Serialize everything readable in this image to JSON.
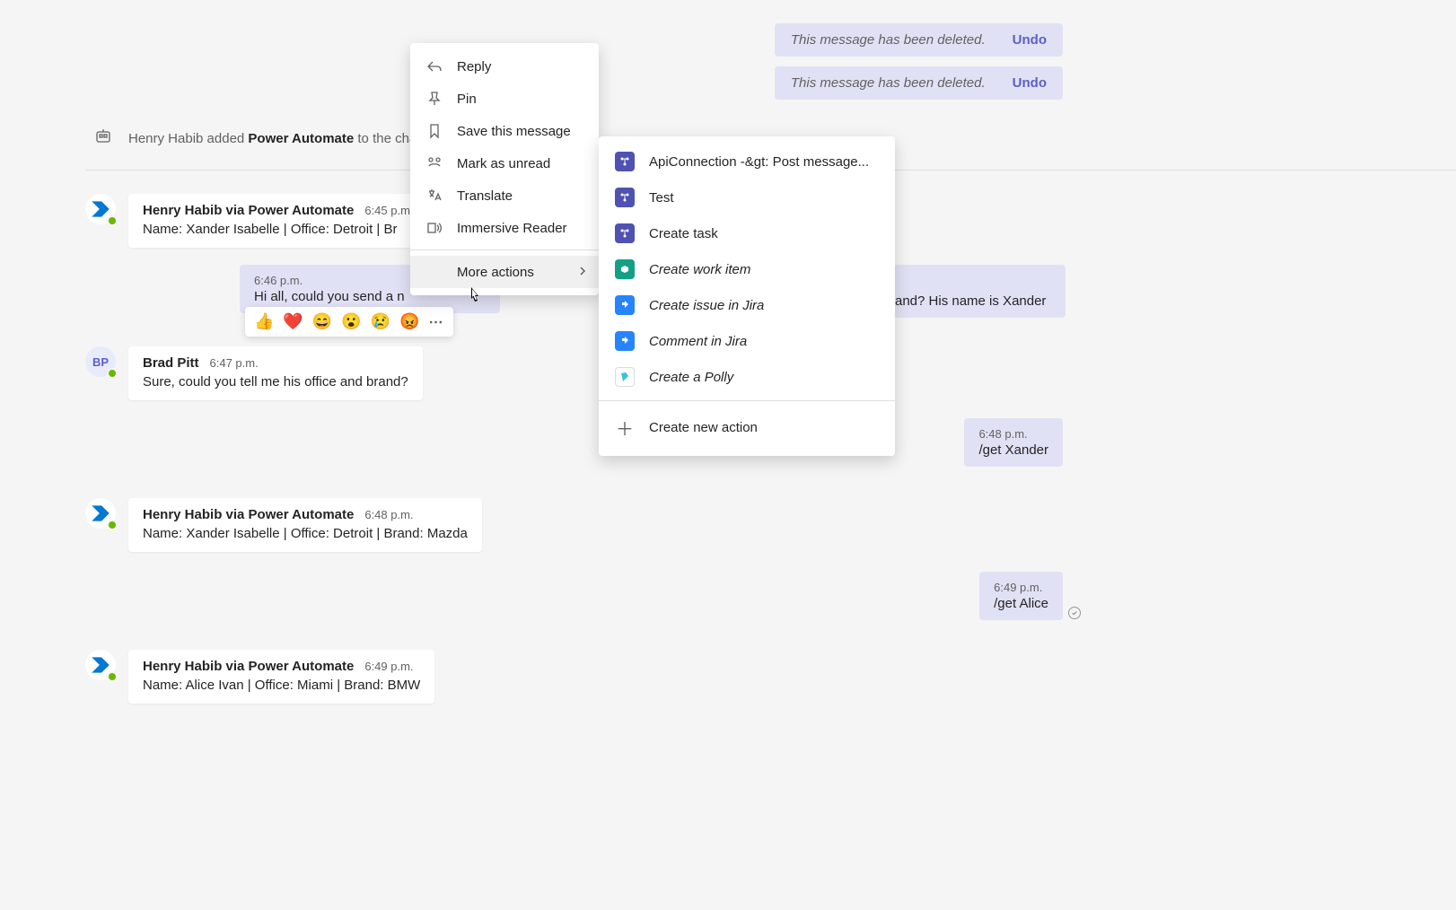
{
  "deleted": [
    {
      "text": "This message has been deleted.",
      "undo": "Undo"
    },
    {
      "text": "This message has been deleted.",
      "undo": "Undo"
    }
  ],
  "system_event": {
    "prefix": "Henry Habib added ",
    "bold": "Power Automate",
    "suffix": " to the chat."
  },
  "messages": {
    "pa1": {
      "name": "Henry Habib via Power Automate",
      "time": "6:45 p.m.",
      "body": "Name: Xander Isabelle | Office: Detroit | Br"
    },
    "mine_partial": {
      "time": "6:46 p.m.",
      "body": "Hi all, could you send a n",
      "body_right": "and? His name is Xander"
    },
    "bp": {
      "name": "Brad Pitt",
      "time": "6:47 p.m.",
      "body": "Sure, could you tell me his office and brand?",
      "initials": "BP"
    },
    "mine_xander": {
      "time": "6:48 p.m.",
      "body": "/get Xander"
    },
    "pa2": {
      "name": "Henry Habib via Power Automate",
      "time": "6:48 p.m.",
      "body": "Name: Xander Isabelle | Office: Detroit | Brand: Mazda"
    },
    "mine_alice": {
      "time": "6:49 p.m.",
      "body": "/get Alice"
    },
    "pa3": {
      "name": "Henry Habib via Power Automate",
      "time": "6:49 p.m.",
      "body": "Name: Alice Ivan | Office: Miami | Brand: BMW"
    }
  },
  "reactions": [
    "👍",
    "❤️",
    "😄",
    "😮",
    "😢",
    "😡"
  ],
  "context_menu": {
    "items": [
      {
        "label": "Reply"
      },
      {
        "label": "Pin"
      },
      {
        "label": "Save this message"
      },
      {
        "label": "Mark as unread"
      },
      {
        "label": "Translate"
      },
      {
        "label": "Immersive Reader"
      }
    ],
    "more_actions": "More actions"
  },
  "submenu": {
    "items": [
      {
        "label": "ApiConnection -&gt: Post message...",
        "icon": "blue"
      },
      {
        "label": "Test",
        "icon": "blue"
      },
      {
        "label": "Create task",
        "icon": "blue"
      },
      {
        "label": "Create work item",
        "icon": "teal",
        "italic": true
      },
      {
        "label": "Create issue in Jira",
        "icon": "jira",
        "italic": true
      },
      {
        "label": "Comment in Jira",
        "icon": "jira",
        "italic": true
      },
      {
        "label": "Create a Polly",
        "icon": "polly",
        "italic": true
      }
    ],
    "create_new": "Create new action"
  }
}
